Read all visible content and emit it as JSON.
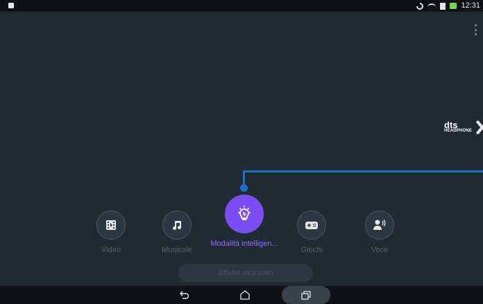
{
  "status_bar": {
    "time": "12:31",
    "icons": [
      "notification-icon",
      "moon-icon",
      "wifi-icon",
      "sim-icon",
      "battery-charging-icon"
    ]
  },
  "header": {
    "overflow_icon": "more-vert-icon"
  },
  "brand": {
    "logo_text": "dts",
    "logo_sub": "HEADPHONE",
    "logo_mark": "X"
  },
  "modes": {
    "items": [
      {
        "label": "Video",
        "icon": "video-icon",
        "active": false
      },
      {
        "label": "Musicale",
        "icon": "music-note-icon",
        "active": false
      },
      {
        "label": "Modalità intelligen...",
        "icon": "lightbulb-icon",
        "active": true
      },
      {
        "label": "Giochi",
        "icon": "gamepad-icon",
        "active": false
      },
      {
        "label": "Voce",
        "icon": "voice-icon",
        "active": false
      }
    ]
  },
  "advanced": {
    "label": "Effetto avanzato"
  },
  "navbar": {
    "icons": [
      "back-icon",
      "home-icon",
      "recent-apps-icon"
    ]
  },
  "colors": {
    "background": "#1f2a33",
    "accent_purple": "#7b4ef3",
    "connector_blue": "#1d6fc8",
    "bar": "#0e1215"
  }
}
